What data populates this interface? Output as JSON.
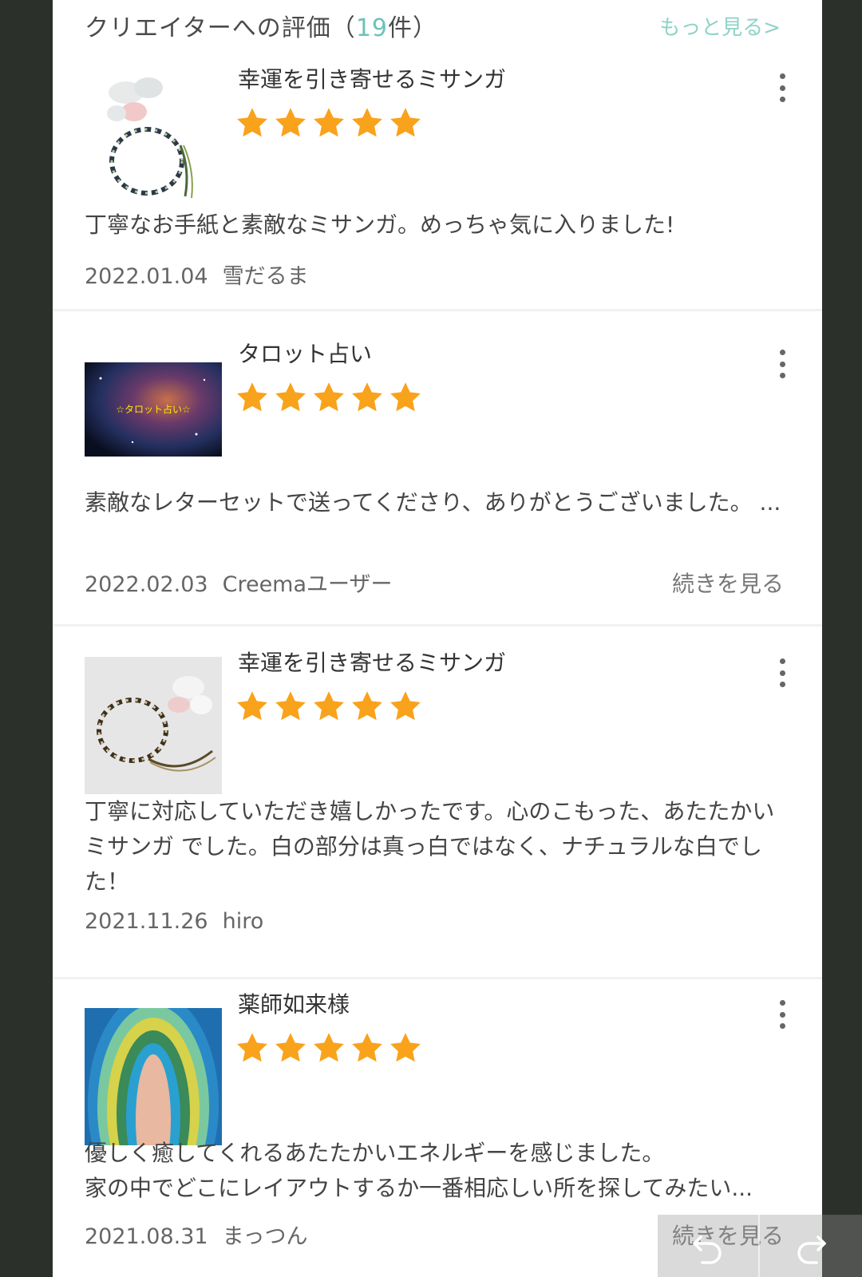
{
  "header": {
    "title": "クリエイターへの評価（",
    "count": "19",
    "suffix": "件）",
    "more": "もっと見る>"
  },
  "reviews": [
    {
      "product": "幸運を引き寄せるミサンガ",
      "rating": 5,
      "comment": "丁寧なお手紙と素敵なミサンガ。めっちゃ気に入りました!",
      "date": "2022.01.04",
      "author": "雪だるま",
      "readmore": ""
    },
    {
      "product": "タロット占い",
      "rating": 5,
      "comment": "素敵なレターセットで送ってくださり、ありがとうございました。 ...",
      "date": "2022.02.03",
      "author": "Creemaユーザー",
      "readmore": "続きを見る",
      "thumb_text": "☆タロット占い☆"
    },
    {
      "product": "幸運を引き寄せるミサンガ",
      "rating": 5,
      "comment": "丁寧に対応していただき嬉しかったです。心のこもった、あたたかいミサンガ でした。白の部分は真っ白ではなく、ナチュラルな白でした！",
      "date": "2021.11.26",
      "author": "hiro",
      "readmore": ""
    },
    {
      "product": "薬師如来様",
      "rating": 5,
      "comment": "優しく癒してくれるあたたかいエネルギーを感じました。\n家の中でどこにレイアウトするか一番相応しい所を探してみたい...",
      "date": "2021.08.31",
      "author": "まっつん",
      "readmore": "続きを見る"
    }
  ],
  "colors": {
    "star": "#f9a21b",
    "accent": "#6cc3b9",
    "background": "#2b302b"
  },
  "icons": [
    "more-vertical-icon",
    "star-icon",
    "undo-icon",
    "redo-icon"
  ]
}
